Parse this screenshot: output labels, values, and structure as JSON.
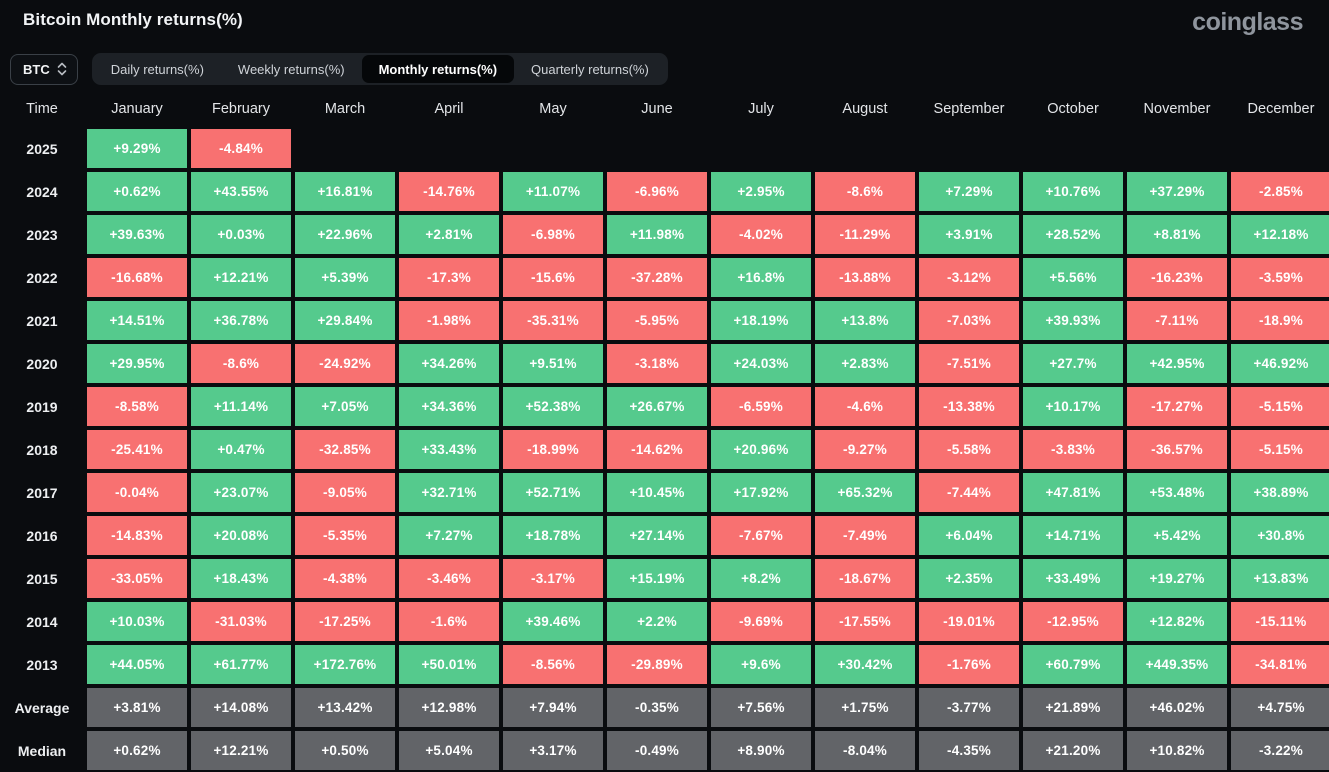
{
  "header": {
    "title": "Bitcoin Monthly returns(%)",
    "logo": "coinglass"
  },
  "controls": {
    "coin": "BTC",
    "tabs": [
      {
        "label": "Daily returns(%)",
        "active": false
      },
      {
        "label": "Weekly returns(%)",
        "active": false
      },
      {
        "label": "Monthly returns(%)",
        "active": true
      },
      {
        "label": "Quarterly returns(%)",
        "active": false
      }
    ]
  },
  "colors": {
    "positive": "#55ca8d",
    "negative": "#f87171",
    "summary": "#626468",
    "background": "#0a0c0f"
  },
  "table": {
    "time_header": "Time",
    "months": [
      "January",
      "February",
      "March",
      "April",
      "May",
      "June",
      "July",
      "August",
      "September",
      "October",
      "November",
      "December"
    ],
    "rows": [
      {
        "label": "2025",
        "type": "year",
        "values": [
          "+9.29%",
          "-4.84%",
          null,
          null,
          null,
          null,
          null,
          null,
          null,
          null,
          null,
          null
        ]
      },
      {
        "label": "2024",
        "type": "year",
        "values": [
          "+0.62%",
          "+43.55%",
          "+16.81%",
          "-14.76%",
          "+11.07%",
          "-6.96%",
          "+2.95%",
          "-8.6%",
          "+7.29%",
          "+10.76%",
          "+37.29%",
          "-2.85%"
        ]
      },
      {
        "label": "2023",
        "type": "year",
        "values": [
          "+39.63%",
          "+0.03%",
          "+22.96%",
          "+2.81%",
          "-6.98%",
          "+11.98%",
          "-4.02%",
          "-11.29%",
          "+3.91%",
          "+28.52%",
          "+8.81%",
          "+12.18%"
        ]
      },
      {
        "label": "2022",
        "type": "year",
        "values": [
          "-16.68%",
          "+12.21%",
          "+5.39%",
          "-17.3%",
          "-15.6%",
          "-37.28%",
          "+16.8%",
          "-13.88%",
          "-3.12%",
          "+5.56%",
          "-16.23%",
          "-3.59%"
        ]
      },
      {
        "label": "2021",
        "type": "year",
        "values": [
          "+14.51%",
          "+36.78%",
          "+29.84%",
          "-1.98%",
          "-35.31%",
          "-5.95%",
          "+18.19%",
          "+13.8%",
          "-7.03%",
          "+39.93%",
          "-7.11%",
          "-18.9%"
        ]
      },
      {
        "label": "2020",
        "type": "year",
        "values": [
          "+29.95%",
          "-8.6%",
          "-24.92%",
          "+34.26%",
          "+9.51%",
          "-3.18%",
          "+24.03%",
          "+2.83%",
          "-7.51%",
          "+27.7%",
          "+42.95%",
          "+46.92%"
        ]
      },
      {
        "label": "2019",
        "type": "year",
        "values": [
          "-8.58%",
          "+11.14%",
          "+7.05%",
          "+34.36%",
          "+52.38%",
          "+26.67%",
          "-6.59%",
          "-4.6%",
          "-13.38%",
          "+10.17%",
          "-17.27%",
          "-5.15%"
        ]
      },
      {
        "label": "2018",
        "type": "year",
        "values": [
          "-25.41%",
          "+0.47%",
          "-32.85%",
          "+33.43%",
          "-18.99%",
          "-14.62%",
          "+20.96%",
          "-9.27%",
          "-5.58%",
          "-3.83%",
          "-36.57%",
          "-5.15%"
        ]
      },
      {
        "label": "2017",
        "type": "year",
        "values": [
          "-0.04%",
          "+23.07%",
          "-9.05%",
          "+32.71%",
          "+52.71%",
          "+10.45%",
          "+17.92%",
          "+65.32%",
          "-7.44%",
          "+47.81%",
          "+53.48%",
          "+38.89%"
        ]
      },
      {
        "label": "2016",
        "type": "year",
        "values": [
          "-14.83%",
          "+20.08%",
          "-5.35%",
          "+7.27%",
          "+18.78%",
          "+27.14%",
          "-7.67%",
          "-7.49%",
          "+6.04%",
          "+14.71%",
          "+5.42%",
          "+30.8%"
        ]
      },
      {
        "label": "2015",
        "type": "year",
        "values": [
          "-33.05%",
          "+18.43%",
          "-4.38%",
          "-3.46%",
          "-3.17%",
          "+15.19%",
          "+8.2%",
          "-18.67%",
          "+2.35%",
          "+33.49%",
          "+19.27%",
          "+13.83%"
        ]
      },
      {
        "label": "2014",
        "type": "year",
        "values": [
          "+10.03%",
          "-31.03%",
          "-17.25%",
          "-1.6%",
          "+39.46%",
          "+2.2%",
          "-9.69%",
          "-17.55%",
          "-19.01%",
          "-12.95%",
          "+12.82%",
          "-15.11%"
        ]
      },
      {
        "label": "2013",
        "type": "year",
        "values": [
          "+44.05%",
          "+61.77%",
          "+172.76%",
          "+50.01%",
          "-8.56%",
          "-29.89%",
          "+9.6%",
          "+30.42%",
          "-1.76%",
          "+60.79%",
          "+449.35%",
          "-34.81%"
        ]
      },
      {
        "label": "Average",
        "type": "summary",
        "values": [
          "+3.81%",
          "+14.08%",
          "+13.42%",
          "+12.98%",
          "+7.94%",
          "-0.35%",
          "+7.56%",
          "+1.75%",
          "-3.77%",
          "+21.89%",
          "+46.02%",
          "+4.75%"
        ]
      },
      {
        "label": "Median",
        "type": "summary",
        "values": [
          "+0.62%",
          "+12.21%",
          "+0.50%",
          "+5.04%",
          "+3.17%",
          "-0.49%",
          "+8.90%",
          "-8.04%",
          "-4.35%",
          "+21.20%",
          "+10.82%",
          "-3.22%"
        ]
      }
    ]
  }
}
